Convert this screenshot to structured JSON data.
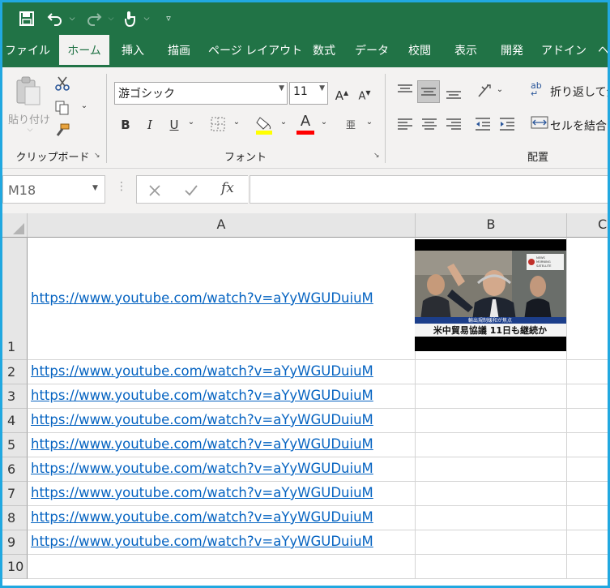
{
  "quick_access": {
    "save_icon": "save-icon",
    "undo_icon": "undo-icon",
    "redo_icon": "redo-icon",
    "touch_icon": "touch-mode-icon",
    "customize_icon": "customize-icon"
  },
  "tabs": [
    {
      "label": "ファイル",
      "active": false
    },
    {
      "label": "ホーム",
      "active": true
    },
    {
      "label": "挿入",
      "active": false
    },
    {
      "label": "描画",
      "active": false
    },
    {
      "label": "ページ レイアウト",
      "active": false
    },
    {
      "label": "数式",
      "active": false
    },
    {
      "label": "データ",
      "active": false
    },
    {
      "label": "校閲",
      "active": false
    },
    {
      "label": "表示",
      "active": false
    },
    {
      "label": "開発",
      "active": false
    },
    {
      "label": "アドイン",
      "active": false
    },
    {
      "label": "ヘ",
      "active": false
    }
  ],
  "ribbon": {
    "clipboard": {
      "label": "クリップボード",
      "paste_label": "貼り付け"
    },
    "font": {
      "label": "フォント",
      "font_name": "游ゴシック",
      "font_size": "11",
      "bold": "B",
      "italic": "I",
      "underline": "U",
      "grow": "A",
      "shrink": "A",
      "font_color_glyph": "A",
      "font_color": "#ff0000",
      "fill_color": "#ffff00"
    },
    "alignment": {
      "label": "配置",
      "wrap_text": "折り返して全",
      "merge": "セルを結合し"
    }
  },
  "formula_bar": {
    "name_box": "M18",
    "fx": "fx",
    "formula": ""
  },
  "sheet": {
    "columns": [
      "A",
      "B",
      "C"
    ],
    "rows": [
      {
        "num": "1",
        "a": "https://www.youtube.com/watch?v=aYyWGUDuiuM"
      },
      {
        "num": "2",
        "a": "https://www.youtube.com/watch?v=aYyWGUDuiuM"
      },
      {
        "num": "3",
        "a": "https://www.youtube.com/watch?v=aYyWGUDuiuM"
      },
      {
        "num": "4",
        "a": "https://www.youtube.com/watch?v=aYyWGUDuiuM"
      },
      {
        "num": "5",
        "a": "https://www.youtube.com/watch?v=aYyWGUDuiuM"
      },
      {
        "num": "6",
        "a": "https://www.youtube.com/watch?v=aYyWGUDuiuM"
      },
      {
        "num": "7",
        "a": "https://www.youtube.com/watch?v=aYyWGUDuiuM"
      },
      {
        "num": "8",
        "a": "https://www.youtube.com/watch?v=aYyWGUDuiuM"
      },
      {
        "num": "9",
        "a": "https://www.youtube.com/watch?v=aYyWGUDuiuM"
      },
      {
        "num": "10",
        "a": ""
      }
    ],
    "thumbnail": {
      "news_badge": "NEWS MORNING SATELLITE",
      "caption_small": "輸出規制緩和が焦点",
      "caption": "米中貿易協議 11日も継続か"
    }
  },
  "colors": {
    "excel_green": "#217346",
    "frame_blue": "#21a8e0",
    "link_blue": "#0563c1"
  }
}
